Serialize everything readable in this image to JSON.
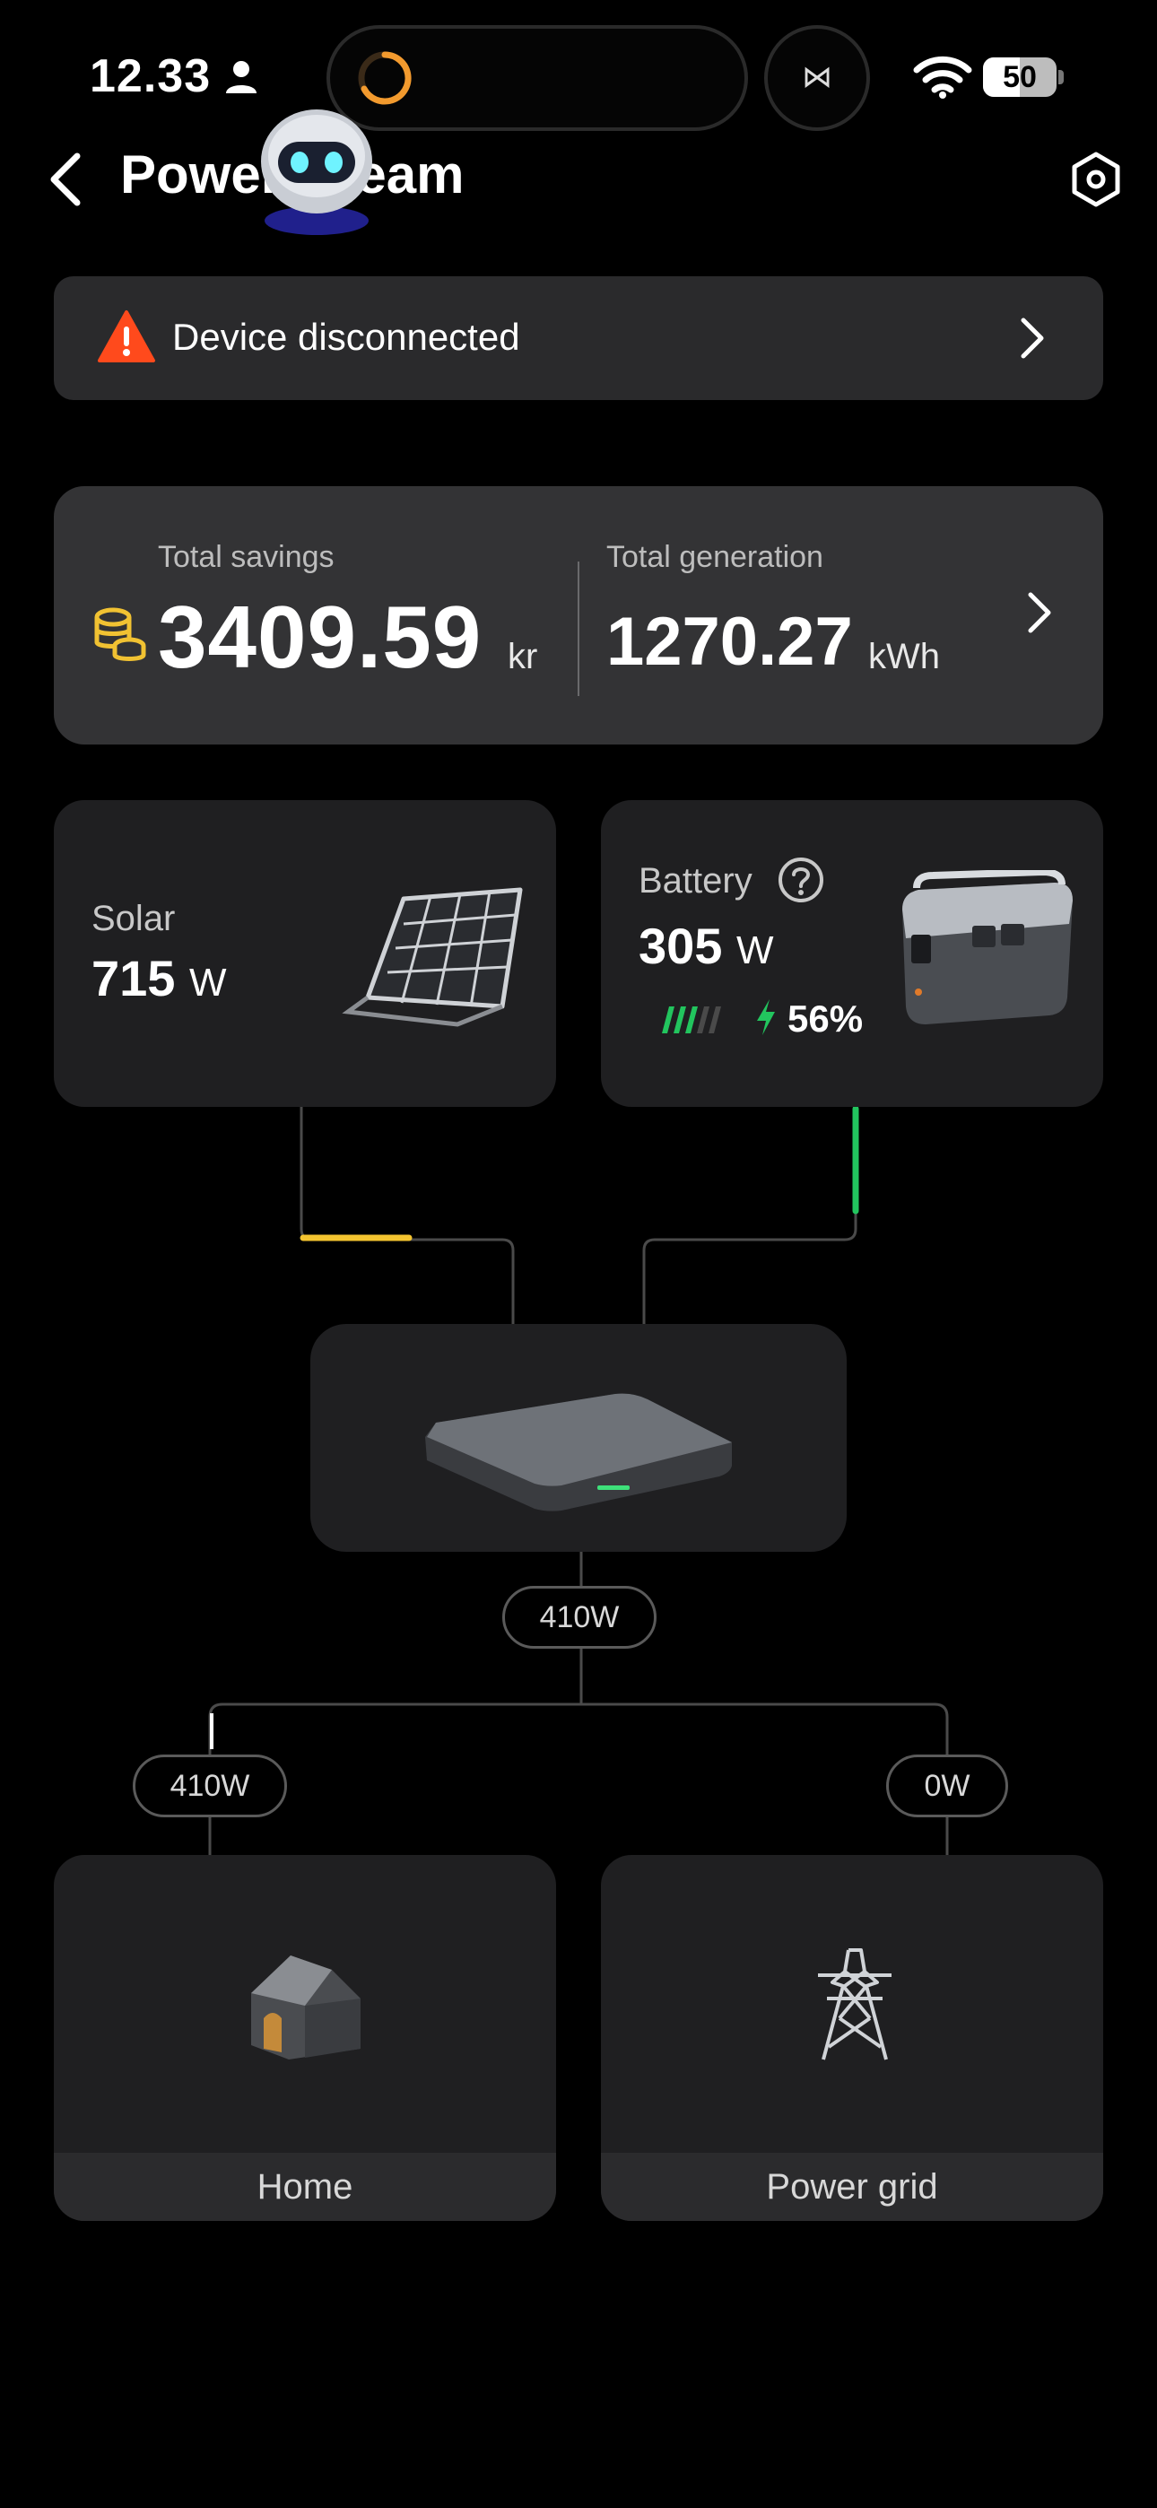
{
  "status_bar": {
    "time": "12.33",
    "battery_level": "50",
    "island_icon": "⋈"
  },
  "header": {
    "title": "PowerStream"
  },
  "alert": {
    "message": "Device disconnected"
  },
  "totals": {
    "savings_label": "Total savings",
    "savings_value": "3409.59",
    "savings_unit": "kr",
    "generation_label": "Total generation",
    "generation_value": "1270.27",
    "generation_unit": "kWh"
  },
  "solar": {
    "label": "Solar",
    "value": "715",
    "unit": "W"
  },
  "battery": {
    "label": "Battery",
    "value": "305",
    "unit": "W",
    "soc": "56%",
    "soc_fraction": 0.56
  },
  "flow": {
    "hub_output": "410W",
    "home_output": "410W",
    "grid_output": "0W"
  },
  "home": {
    "label": "Home"
  },
  "grid": {
    "label": "Power grid"
  },
  "colors": {
    "solar_flow": "#f4c430",
    "battery_flow": "#22c55e",
    "alert": "#ff4a1c",
    "coins": "#f1c232"
  }
}
